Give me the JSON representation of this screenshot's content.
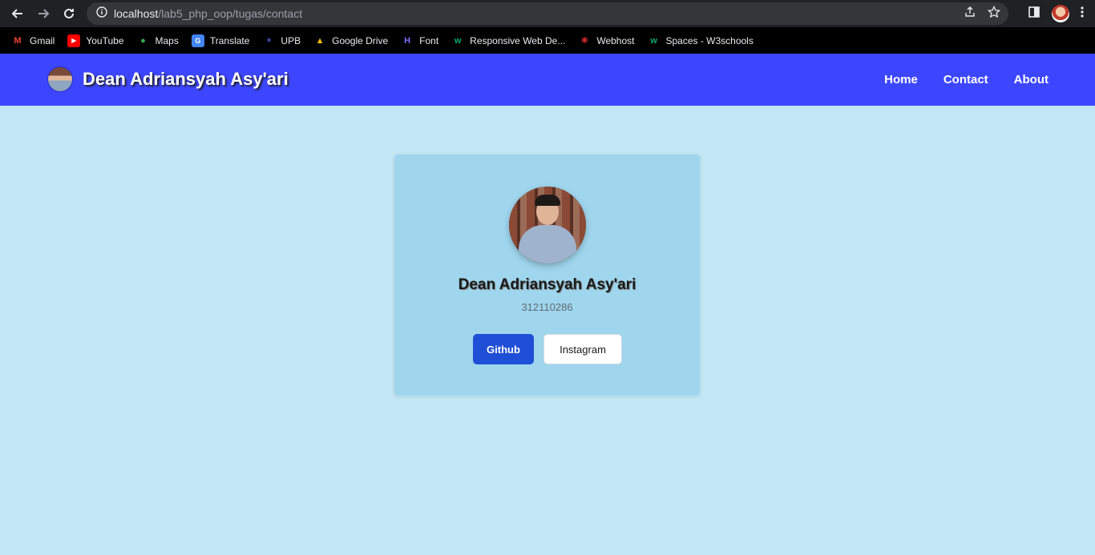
{
  "browser": {
    "url_host": "localhost",
    "url_path": "/lab5_php_oop/tugas/contact",
    "bookmarks": [
      {
        "label": "Gmail",
        "icon": "gmail-icon",
        "color": "#ea4335"
      },
      {
        "label": "YouTube",
        "icon": "youtube-icon",
        "color": "#ff0000"
      },
      {
        "label": "Maps",
        "icon": "maps-icon",
        "color": "#34a853"
      },
      {
        "label": "Translate",
        "icon": "translate-icon",
        "color": "#4285f4"
      },
      {
        "label": "UPB",
        "icon": "upb-icon",
        "color": "#1a237e"
      },
      {
        "label": "Google Drive",
        "icon": "drive-icon",
        "color": "#fbbc04"
      },
      {
        "label": "Font",
        "icon": "font-icon",
        "color": "#5b4dff"
      },
      {
        "label": "Responsive Web De...",
        "icon": "w3schools-icon",
        "color": "#04aa6d"
      },
      {
        "label": "Webhost",
        "icon": "webhost-icon",
        "color": "#c62828"
      },
      {
        "label": "Spaces - W3schools",
        "icon": "w3schools-icon",
        "color": "#04aa6d"
      }
    ]
  },
  "navbar": {
    "brand": "Dean Adriansyah Asy'ari",
    "links": [
      "Home",
      "Contact",
      "About"
    ],
    "bg_color": "#3d46ff"
  },
  "card": {
    "name": "Dean Adriansyah Asy'ari",
    "nim": "312110286",
    "buttons": {
      "github": "Github",
      "instagram": "Instagram"
    }
  },
  "colors": {
    "page_bg": "#c3e6f5",
    "card_bg": "#9fd6ee",
    "primary": "#1f4fd6"
  }
}
